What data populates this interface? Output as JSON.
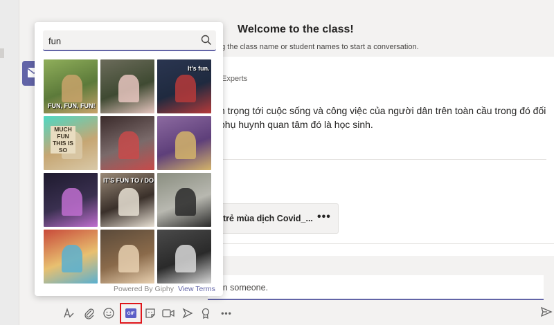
{
  "channel": {
    "title": "Welcome to the class!",
    "subtitle": "ng the class name or student names to start a conversation."
  },
  "post": {
    "author": "Experts",
    "text_line1": "n trọng tới cuộc sống và công việc của người dân trên toàn cầu trong đó đối",
    "text_line2": "phụ huynh quan tâm đó là học sinh.",
    "attachment_name": "trẻ mùa dịch Covid_...",
    "attachment_more": "•••"
  },
  "compose": {
    "placeholder_visible": "ion someone."
  },
  "gif_picker": {
    "search_value": "fun",
    "footer_powered": "Powered By Giphy",
    "footer_terms": "View Terms",
    "gifs": [
      {
        "caption": "FUN, FUN, FUN!",
        "colors": [
          "#8fae5a",
          "#c9a36b",
          "#5c7a3a"
        ]
      },
      {
        "caption": "",
        "colors": [
          "#6b6b5a",
          "#e7c6c0",
          "#3f4a32"
        ]
      },
      {
        "caption": "It's fun.",
        "colors": [
          "#2a3550",
          "#b63a3a",
          "#1f2a3f"
        ]
      },
      {
        "caption": "MUCH FUN THIS IS SO",
        "colors": [
          "#4fd8c3",
          "#d9c9a8",
          "#c6a673"
        ]
      },
      {
        "caption": "",
        "colors": [
          "#3a2a2a",
          "#c84a4a",
          "#7a6a6a"
        ]
      },
      {
        "caption": "",
        "colors": [
          "#8c6aa0",
          "#d4b46a",
          "#5e3f7a"
        ]
      },
      {
        "caption": "",
        "colors": [
          "#1e1a2e",
          "#c06fd0",
          "#3a3050"
        ]
      },
      {
        "caption": "IT'S FUN TO / DO BAD",
        "colors": [
          "#9a8a78",
          "#e8e0d4",
          "#3a302a"
        ]
      },
      {
        "caption": "",
        "colors": [
          "#8a8e80",
          "#2a2a2a",
          "#b8b8b0"
        ]
      },
      {
        "caption": "",
        "colors": [
          "#c84a3a",
          "#5ab0d0",
          "#e8c070"
        ]
      },
      {
        "caption": "",
        "colors": [
          "#5a4a3a",
          "#e8d0b0",
          "#8a6a4a"
        ]
      },
      {
        "caption": "",
        "colors": [
          "#4a4a4a",
          "#d8d8d8",
          "#2a2a2a"
        ]
      }
    ]
  },
  "toolbar": {
    "gif_label": "GIF",
    "more_label": "•••"
  },
  "colors": {
    "accent": "#6264a7",
    "highlight_box": "#e0161b",
    "background": "#f3f2f1"
  }
}
